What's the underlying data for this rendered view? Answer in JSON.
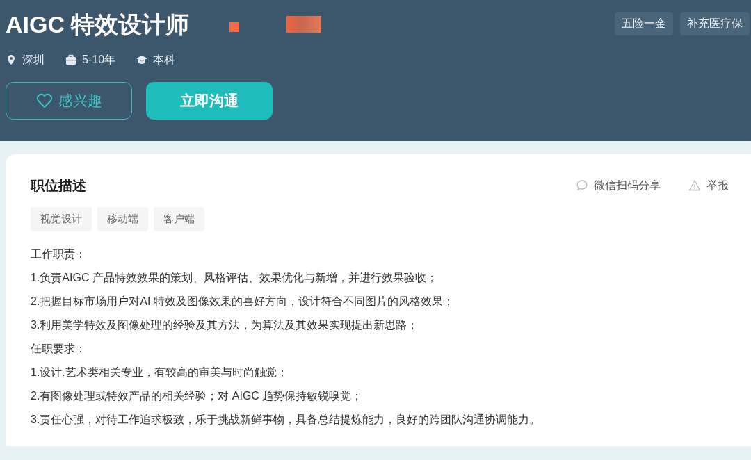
{
  "job": {
    "title": "AIGC 特效设计师",
    "meta": [
      {
        "kind": "location",
        "text": "深圳"
      },
      {
        "kind": "experience",
        "text": "5-10年"
      },
      {
        "kind": "education",
        "text": "本科"
      }
    ],
    "benefits": [
      "五险一金",
      "补充医疗保"
    ],
    "buttons": [
      {
        "kind": "interest",
        "label": "感兴趣"
      },
      {
        "kind": "chat",
        "label": "立即沟通"
      }
    ]
  },
  "description": {
    "heading": "职位描述",
    "actions": [
      {
        "kind": "share",
        "label": "微信扫码分享"
      },
      {
        "kind": "report",
        "label": "举报"
      }
    ],
    "tags": [
      "视觉设计",
      "移动端",
      "客户端"
    ],
    "lines": [
      "工作职责：",
      "1.负责AIGC 产品特效效果的策划、风格评估、效果优化与新增，并进行效果验收；",
      "2.把握目标市场用户对AI 特效及图像效果的喜好方向，设计符合不同图片的风格效果；",
      "3.利用美学特效及图像处理的经验及其方法，为算法及其效果实现提出新思路；",
      "任职要求：",
      "1.设计.艺术类相关专业，有较高的审美与时尚触觉；",
      "2.有图像处理或特效产品的相关经验；对 AIGC 趋势保持敏锐嗅觉；",
      "3.责任心强，对待工作追求极致，乐于挑战新鲜事物，具备总结提炼能力，良好的跨团队沟通协调能力。"
    ]
  }
}
